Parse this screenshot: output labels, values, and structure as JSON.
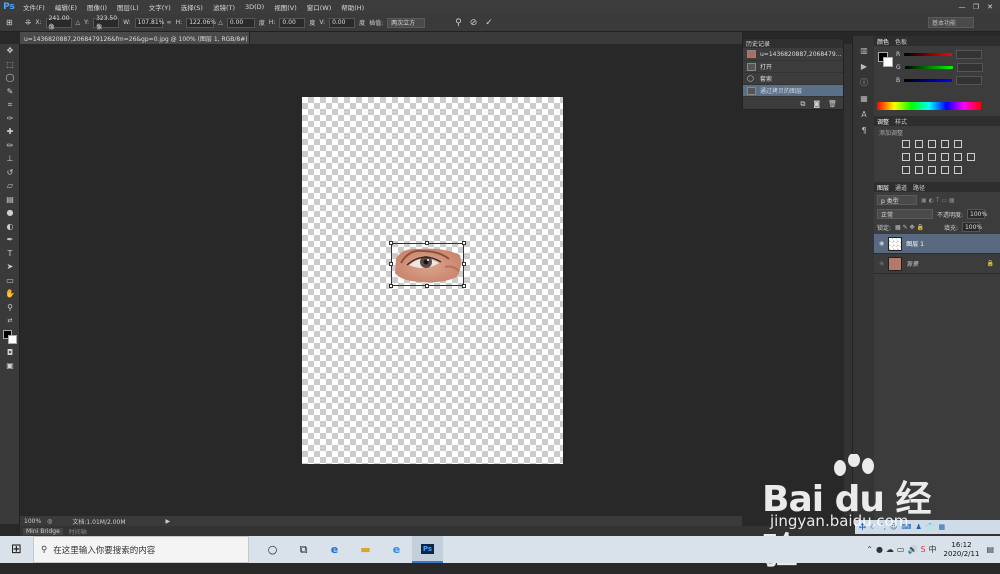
{
  "app": {
    "logo": "Ps"
  },
  "menu": [
    "文件(F)",
    "编辑(E)",
    "图像(I)",
    "图层(L)",
    "文字(Y)",
    "选择(S)",
    "滤镜(T)",
    "3D(D)",
    "视图(V)",
    "窗口(W)",
    "帮助(H)"
  ],
  "window_controls": [
    "—",
    "❐",
    "✕"
  ],
  "options": {
    "x_label": "X:",
    "x_value": "241.00 像",
    "y_label": "Y:",
    "y_value": "323.50 像",
    "w_label": "W:",
    "w_value": "107.81%",
    "h_label": "H:",
    "h_value": "122.06%",
    "angle_value": "0.00",
    "angle_unit": "度",
    "hskew_label": "H:",
    "hskew_value": "0.00",
    "hskew_unit": "度",
    "vskew_label": "V:",
    "vskew_value": "0.00",
    "vskew_unit": "度",
    "interp_label": "插值:",
    "interp_value": "两次立方",
    "workspace": "基本功能"
  },
  "document_tab": "u=1436820887,2068479126&fm=26&gp=0.jpg @ 100% (图层 1, RGB/8#) *",
  "status": {
    "zoom": "100%",
    "doc_info": "文档:1.01M/2.00M"
  },
  "bridge": {
    "tab1": "Mini Bridge",
    "tab2": "时间轴"
  },
  "history": {
    "tab": "历史记录",
    "snapshot": "u=1436820887,2068479...",
    "items": [
      {
        "label": "打开"
      },
      {
        "label": "套索"
      },
      {
        "label": "通过拷贝的图层"
      }
    ]
  },
  "color_panel": {
    "tab_active": "颜色",
    "tab2": "色板",
    "r": "R",
    "g": "G",
    "b": "B"
  },
  "adjust_panel": {
    "tab_active": "调整",
    "tab2": "样式",
    "hint": "添加调整"
  },
  "layers_panel": {
    "tab_active": "图层",
    "tab2": "通道",
    "tab3": "路径",
    "kind": "p 类型",
    "blend": "正常",
    "opacity_label": "不透明度:",
    "opacity": "100%",
    "lock_label": "锁定:",
    "fill_label": "填充:",
    "fill": "100%",
    "layers": [
      {
        "name": "图层 1"
      },
      {
        "name": "背景"
      }
    ]
  },
  "taskbar": {
    "search_placeholder": "在这里输入你要搜索的内容",
    "time": "16:12",
    "date": "2020/2/11"
  },
  "watermark": {
    "logo": "Bai du 经验",
    "sub": "jingyan.baidu.com"
  },
  "cn_tray": "中"
}
